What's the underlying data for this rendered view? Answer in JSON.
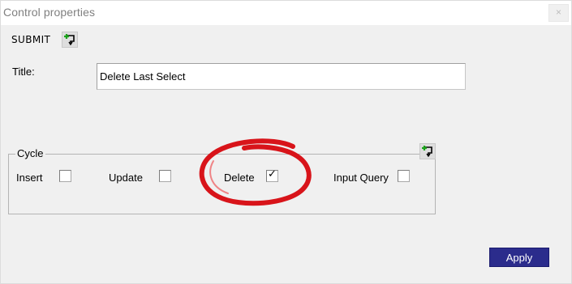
{
  "window": {
    "title": "Control properties",
    "close_glyph": "×"
  },
  "submit": {
    "label": "SUBMIT",
    "icon": "add-query-icon"
  },
  "title_field": {
    "label": "Title:",
    "value": "Delete Last Select"
  },
  "cycle": {
    "legend": "Cycle",
    "icon": "add-query-icon",
    "options": [
      {
        "label": "Insert",
        "checked": false
      },
      {
        "label": "Update",
        "checked": false
      },
      {
        "label": "Delete",
        "checked": true
      },
      {
        "label": "Input Query",
        "checked": false
      }
    ],
    "check_glyph": "✓"
  },
  "annotation": {
    "color": "#d8141a",
    "shape": "hand-drawn-circle"
  },
  "footer": {
    "apply_label": "Apply"
  },
  "colors": {
    "apply_button": "#2b2c8c",
    "icon_green": "#1aa31a"
  }
}
